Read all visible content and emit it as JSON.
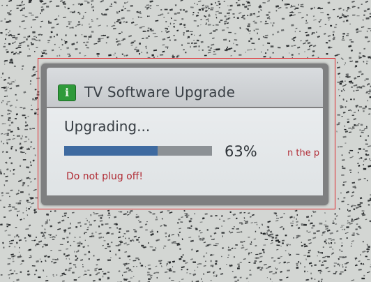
{
  "dialog": {
    "title": "TV Software Upgrade",
    "icon": "info-icon",
    "status": "Upgrading...",
    "progress_percent": 63,
    "progress_label": "63%",
    "background_text": "n the p",
    "warning": "Do not plug off!"
  },
  "colors": {
    "progress_fill": "#3e6aa0",
    "progress_track": "#8c9195",
    "warning_text": "#b02a33",
    "highlight_frame": "#e0262b",
    "icon_green": "#2f9a3a"
  }
}
